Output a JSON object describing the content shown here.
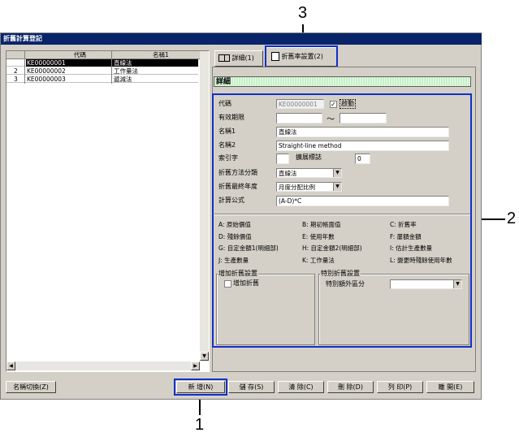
{
  "window": {
    "title": "折舊計算登記"
  },
  "grid": {
    "headers": [
      "代碼",
      "名稱1"
    ],
    "rows": [
      {
        "num": "",
        "code": "KE00000001",
        "name": "直線法",
        "selected": true
      },
      {
        "num": "2",
        "code": "KE00000002",
        "name": "工作量法",
        "selected": false
      },
      {
        "num": "3",
        "code": "KE00000003",
        "name": "遞減法",
        "selected": false
      }
    ]
  },
  "tabs": [
    {
      "label": "詳細(1)"
    },
    {
      "label": "折舊率設置(2)"
    }
  ],
  "detail_header": "詳細",
  "form": {
    "code_label": "代碼",
    "code_value": "KE00000001",
    "enabled_label": "啟動",
    "validity_label": "有效期限",
    "tilde": "～",
    "name1_label": "名稱1",
    "name1_value": "直線法",
    "name2_label": "名稱2",
    "name2_value": "Straight-line method",
    "index_label": "索引字",
    "ext_flag_label": "擴展標誌",
    "ext_flag_value": "0",
    "method_label": "折舊方法分類",
    "method_value": "直線法",
    "final_year_label": "折舊最終年度",
    "final_year_value": "月度分配比例",
    "formula_label": "計算公式",
    "formula_value": "(A-D)*C"
  },
  "legend": [
    [
      "A: 原始價值",
      "B: 期初帳面值",
      "C: 折舊率"
    ],
    [
      "D: 殘餘價值",
      "E: 使用年數",
      "F: 屢額金額"
    ],
    [
      "G: 自定金額1(明細部)",
      "H: 自定金額2(明細部)",
      "I: 估計生產數量"
    ],
    [
      "J: 生產數量",
      "K: 工作量法",
      "L: 變更時殘餘使用年數"
    ]
  ],
  "extra_group": {
    "title": "增加折舊設置",
    "checkbox_label": "增加折舊"
  },
  "special_group": {
    "title": "特別折舊設置",
    "field_label": "特別額外區分"
  },
  "buttons": {
    "name_switch": "名稱切換(Z)",
    "new": "新 增(N)",
    "save": "儲 存(S)",
    "clear": "清 除(C)",
    "delete": "刪 除(D)",
    "print": "列 印(P)",
    "close": "離 開(E)"
  },
  "callouts": {
    "one": "1",
    "two": "2",
    "three": "3"
  },
  "colors": {
    "title_bar": "#0a246a",
    "highlight": "#1030c8",
    "window_bg": "#d4d0c8",
    "detail_bar": "#c8f0c8"
  }
}
